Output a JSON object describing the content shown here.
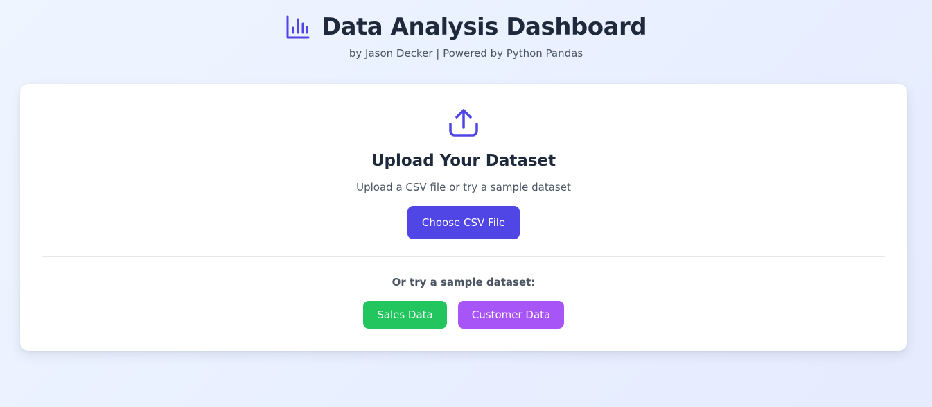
{
  "header": {
    "title": "Data Analysis Dashboard",
    "subtitle": "by Jason Decker | Powered by Python Pandas",
    "title_icon": "bar-chart-icon"
  },
  "upload": {
    "icon": "upload-icon",
    "title": "Upload Your Dataset",
    "description": "Upload a CSV file or try a sample dataset",
    "choose_button_label": "Choose CSV File"
  },
  "samples": {
    "label": "Or try a sample dataset:",
    "sales_button_label": "Sales Data",
    "customer_button_label": "Customer Data"
  },
  "colors": {
    "accent": "#4f46e5",
    "sales": "#22c55e",
    "customer": "#a855f7",
    "heading_text": "#1e293b",
    "muted_text": "#4b5563"
  }
}
